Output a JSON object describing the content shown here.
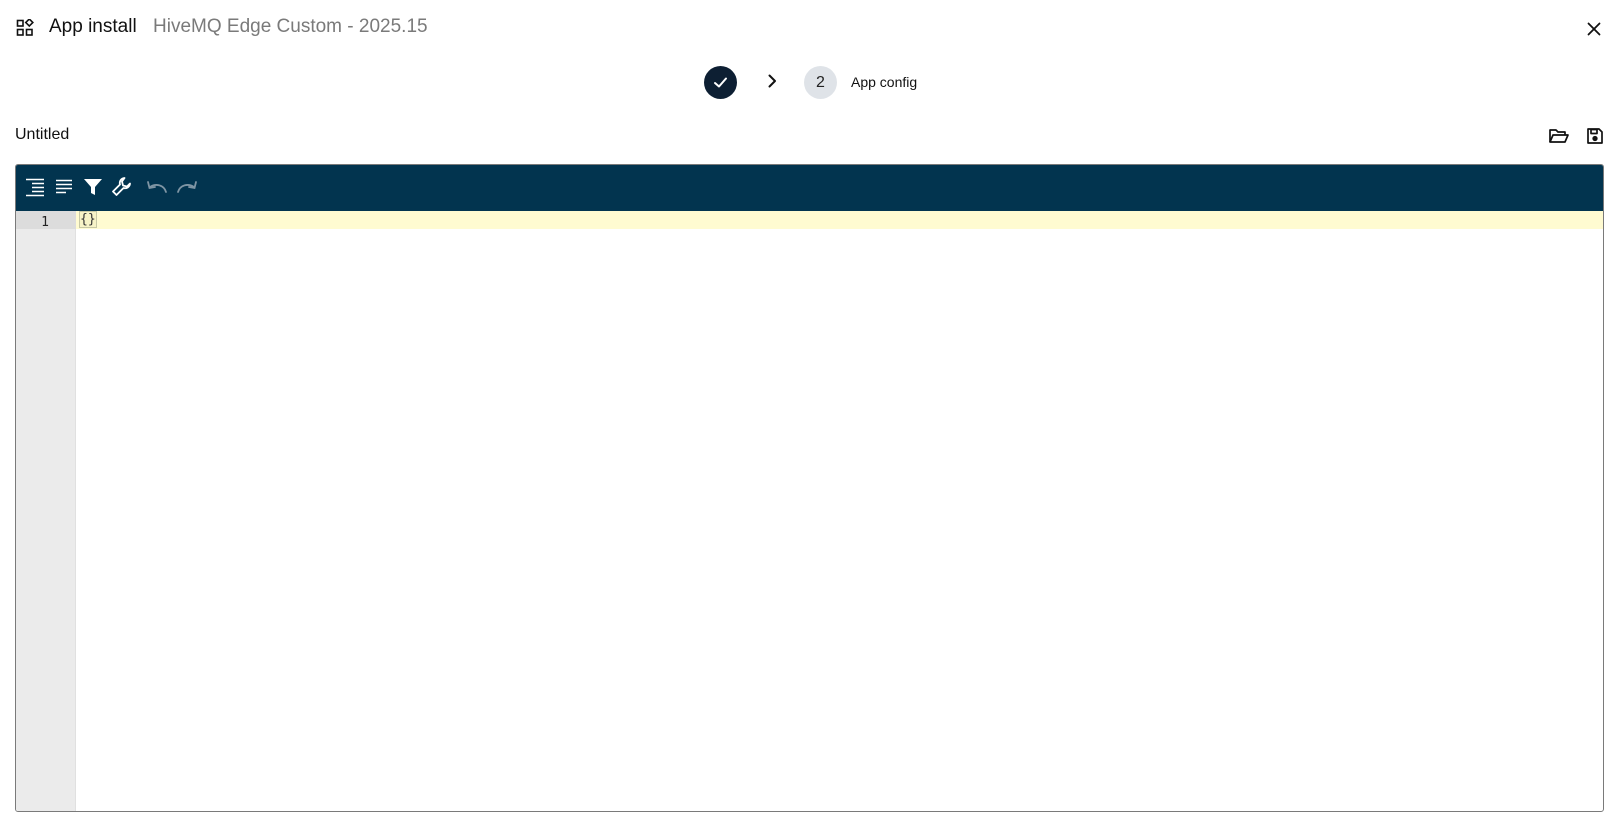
{
  "header": {
    "title": "App install",
    "subtitle": "HiveMQ Edge Custom - 2025.15",
    "apps_icon": "apps-icon",
    "close_icon": "close-icon"
  },
  "stepper": {
    "steps": [
      {
        "state": "completed",
        "icon": "check-icon"
      },
      {
        "number": "2",
        "label": "App config",
        "state": "current"
      }
    ],
    "separator_icon": "chevron-right-icon"
  },
  "document": {
    "title": "Untitled",
    "open_icon": "folder-open-icon",
    "save_icon": "save-icon"
  },
  "editor": {
    "toolbar_icons": [
      "format-icon",
      "compact-icon",
      "filter-icon",
      "repair-icon",
      "undo-icon",
      "redo-icon"
    ],
    "lines": [
      {
        "number": "1",
        "text": "{}"
      }
    ]
  },
  "colors": {
    "toolbar": "#02344f",
    "step_done": "#0d1f33",
    "active_line": "#fffbd1",
    "gutter": "#ebebeb"
  }
}
